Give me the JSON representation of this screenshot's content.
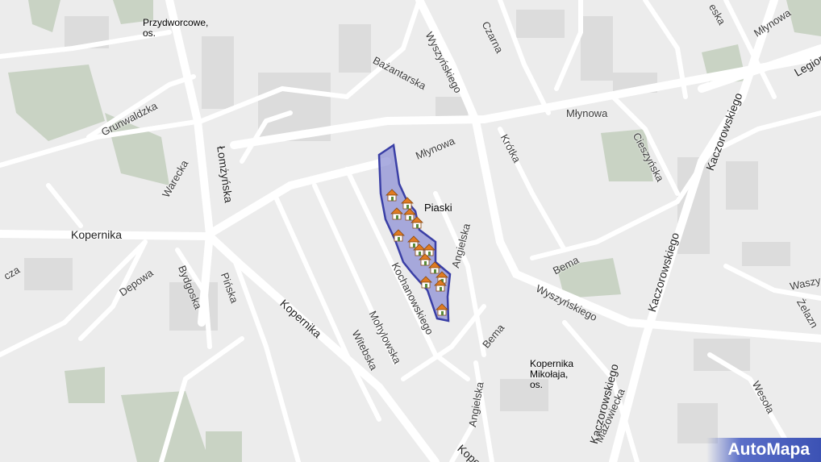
{
  "map": {
    "district_name": "Piaski",
    "branding": "AutoMapa",
    "colors": {
      "background": "#ececec",
      "road": "#ffffff",
      "green": "#c9d3c4",
      "building": "#d9d9d9",
      "highlight_fill": "#8f92d6",
      "highlight_stroke": "#3a3fa6",
      "house_roof": "#e07b22"
    },
    "icons": [
      "house-icon"
    ]
  },
  "places": {
    "przydworcowe_l1": "Przydworcowe,",
    "przydworcowe_l2": "os.",
    "kopernika_os_l1": "Kopernika",
    "kopernika_os_l2": "Mikołaja,",
    "kopernika_os_l3": "os."
  },
  "streets": {
    "grunwaldzka": "Grunwaldzka",
    "bazantarska": "Bażantarska",
    "wyszynskiego_top": "Wyszyńskiego",
    "czarna": "Czarna",
    "mlynowa_center": "Młynowa",
    "mlynowa_right": "Młynowa",
    "mlynowa_topright": "Młynowa",
    "lomzynska": "Łomżyńska",
    "warecka": "Warecka",
    "krotka": "Krótka",
    "cieszynska": "Cieszyńska",
    "kaczorowskiego_top": "Kaczorowskiego",
    "kaczorowskiego_mid": "Kaczorowskiego",
    "kaczorowskiego_bottom": "Kaczorowskiego",
    "legionow": "Legionów",
    "kopernika_left": "Kopernika",
    "kopernika_diag": "Kopernika",
    "kopernika_bottom": "Kope",
    "depowa": "Depowa",
    "bydgoska": "Bydgoska",
    "pinska": "Pińska",
    "angielska_top": "Angielska",
    "angielska_bottom": "Angielska",
    "bema_right": "Bema",
    "bema_lower": "Bema",
    "wyszynskiego_mid": "Wyszyńskiego",
    "waszy": "Waszy",
    "zelazna": "Żelazn",
    "kochanowskiego": "Kochanowskiego",
    "mohylowska": "Mohylowska",
    "witebska": "Witebska",
    "mazowiecka": "Mazowiecka",
    "wesola": "Wesoła",
    "edge_cza": "cza",
    "edge_eska": "eska"
  }
}
